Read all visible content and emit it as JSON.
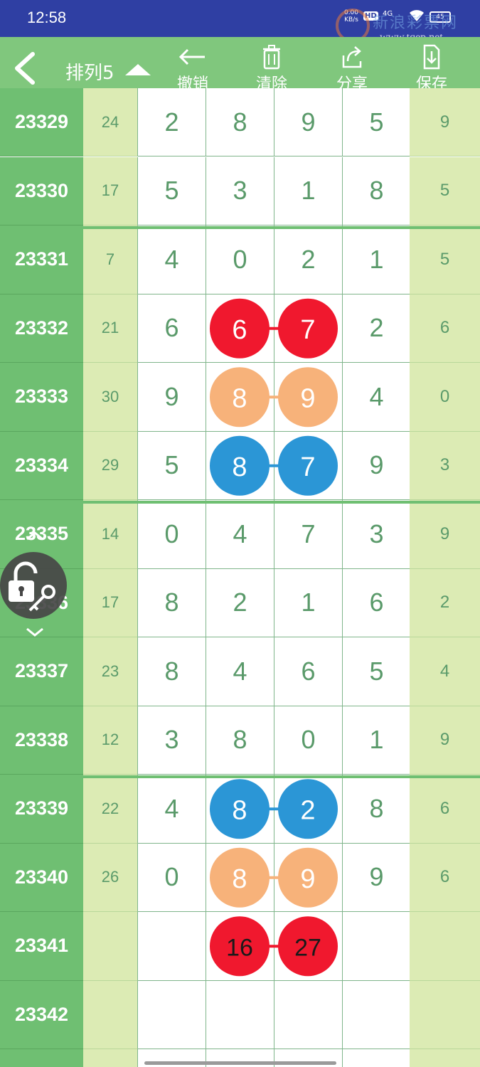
{
  "status_bar": {
    "time": "12:58",
    "net_speed": "0.00",
    "net_unit": "KB/s",
    "hd": "HD",
    "signal": "4G",
    "battery": "45"
  },
  "watermark": {
    "cn": "新浪彩票网",
    "url": "www.tqep.net"
  },
  "toolbar": {
    "title": "排列5",
    "undo_label": "撤销",
    "clear_label": "清除",
    "share_label": "分享",
    "save_label": "保存"
  },
  "rows": [
    {
      "period": "23329",
      "sum": "24",
      "digits": [
        "2",
        "8",
        "9",
        "5"
      ],
      "span": "9"
    },
    {
      "period": "23330",
      "sum": "17",
      "digits": [
        "5",
        "3",
        "1",
        "8"
      ],
      "span": "5"
    },
    {
      "period": "23331",
      "sum": "7",
      "digits": [
        "4",
        "0",
        "2",
        "1"
      ],
      "span": "5"
    },
    {
      "period": "23332",
      "sum": "21",
      "digits": [
        "6",
        "6",
        "7",
        "2"
      ],
      "span": "6"
    },
    {
      "period": "23333",
      "sum": "30",
      "digits": [
        "9",
        "8",
        "9",
        "4"
      ],
      "span": "0"
    },
    {
      "period": "23334",
      "sum": "29",
      "digits": [
        "5",
        "8",
        "7",
        "9"
      ],
      "span": "3"
    },
    {
      "period": "23335",
      "sum": "14",
      "digits": [
        "0",
        "4",
        "7",
        "3"
      ],
      "span": "9"
    },
    {
      "period": "23336",
      "sum": "17",
      "digits": [
        "8",
        "2",
        "1",
        "6"
      ],
      "span": "2"
    },
    {
      "period": "23337",
      "sum": "23",
      "digits": [
        "8",
        "4",
        "6",
        "5"
      ],
      "span": "4"
    },
    {
      "period": "23338",
      "sum": "12",
      "digits": [
        "3",
        "8",
        "0",
        "1"
      ],
      "span": "9"
    },
    {
      "period": "23339",
      "sum": "22",
      "digits": [
        "4",
        "8",
        "2",
        "8"
      ],
      "span": "6"
    },
    {
      "period": "23340",
      "sum": "26",
      "digits": [
        "0",
        "8",
        "9",
        "9"
      ],
      "span": "6"
    },
    {
      "period": "23341",
      "sum": "",
      "digits": [
        "",
        "",
        "",
        ""
      ],
      "span": ""
    },
    {
      "period": "23342",
      "sum": "",
      "digits": [
        "",
        "",
        "",
        ""
      ],
      "span": ""
    },
    {
      "period": "",
      "sum": "",
      "digits": [
        "",
        "",
        "",
        ""
      ],
      "span": ""
    }
  ],
  "highlights": [
    {
      "row": 3,
      "color": "#f0182e",
      "text_color": "#ffffff",
      "values": [
        "6",
        "7"
      ]
    },
    {
      "row": 4,
      "color": "#f7b27a",
      "text_color": "#ffffff",
      "values": [
        "8",
        "9"
      ]
    },
    {
      "row": 5,
      "color": "#2b96d6",
      "text_color": "#ffffff",
      "values": [
        "8",
        "7"
      ]
    },
    {
      "row": 10,
      "color": "#2b96d6",
      "text_color": "#ffffff",
      "values": [
        "8",
        "2"
      ]
    },
    {
      "row": 11,
      "color": "#f7b27a",
      "text_color": "#ffffff",
      "values": [
        "8",
        "9"
      ]
    },
    {
      "row": 12,
      "color": "#f0182e",
      "text_color": "#1a1a1a",
      "values": [
        "16",
        "27"
      ]
    }
  ],
  "colors": {
    "status_bar": "#2f3fa3",
    "toolbar": "#80c77d",
    "period_column": "#6fbf72",
    "light_column": "#dcebb4",
    "digit_text": "#5a9a6a"
  }
}
